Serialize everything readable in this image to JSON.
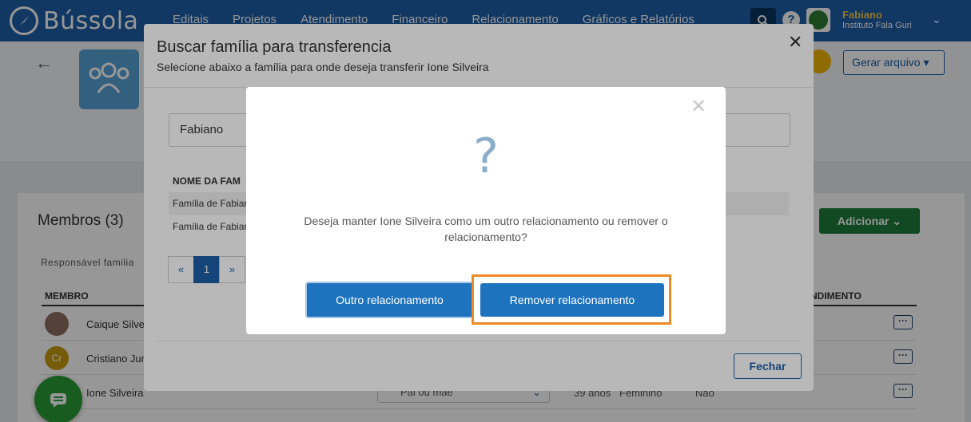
{
  "app": {
    "name": "Bússola"
  },
  "nav": {
    "items": [
      "Editais",
      "Projetos",
      "Atendimento",
      "Financeiro",
      "Relacionamento",
      "Gráficos e Relatórios"
    ],
    "user_name": "Fabiano",
    "user_org": "Instituto Fala Guri"
  },
  "page": {
    "gerar_arquivo": "Gerar arquivo",
    "members_title": "Membros (3)",
    "adicionar": "Adicionar",
    "responsavel_label": "Responsável familia",
    "col_membro": "MEMBRO",
    "col_atendimento": "NDIMENTO",
    "members": [
      {
        "name": "Caique Silvei",
        "initials": ""
      },
      {
        "name": "Cristiano Jun",
        "initials": "Cr"
      },
      {
        "name": "Ione Silveira",
        "initials": "",
        "relation": "Pai ou mãe",
        "age": "39 anos",
        "gender": "Feminino",
        "flag": "Não"
      }
    ]
  },
  "transfer_modal": {
    "title": "Buscar família para transferencia",
    "subtitle": "Selecione abaixo a família para onde deseja transferir Ione Silveira",
    "search_value": "Fabiano",
    "col_header": "NOME DA FAM",
    "rows": [
      "Família de Fabiar",
      "Família de Fabiar"
    ],
    "pager": [
      "«",
      "1",
      "»"
    ],
    "close_label": "Fechar"
  },
  "confirm_modal": {
    "icon": "?",
    "message": "Deseja manter Ione Silveira como um outro relacionamento ou remover o relacionamento?",
    "btn_outro": "Outro relacionamento",
    "btn_remover": "Remover relacionamento"
  },
  "colors": {
    "nav_bg": "#1e5fa8",
    "primary": "#1e73be",
    "highlight": "#f08a24",
    "success": "#1e7d3c"
  }
}
